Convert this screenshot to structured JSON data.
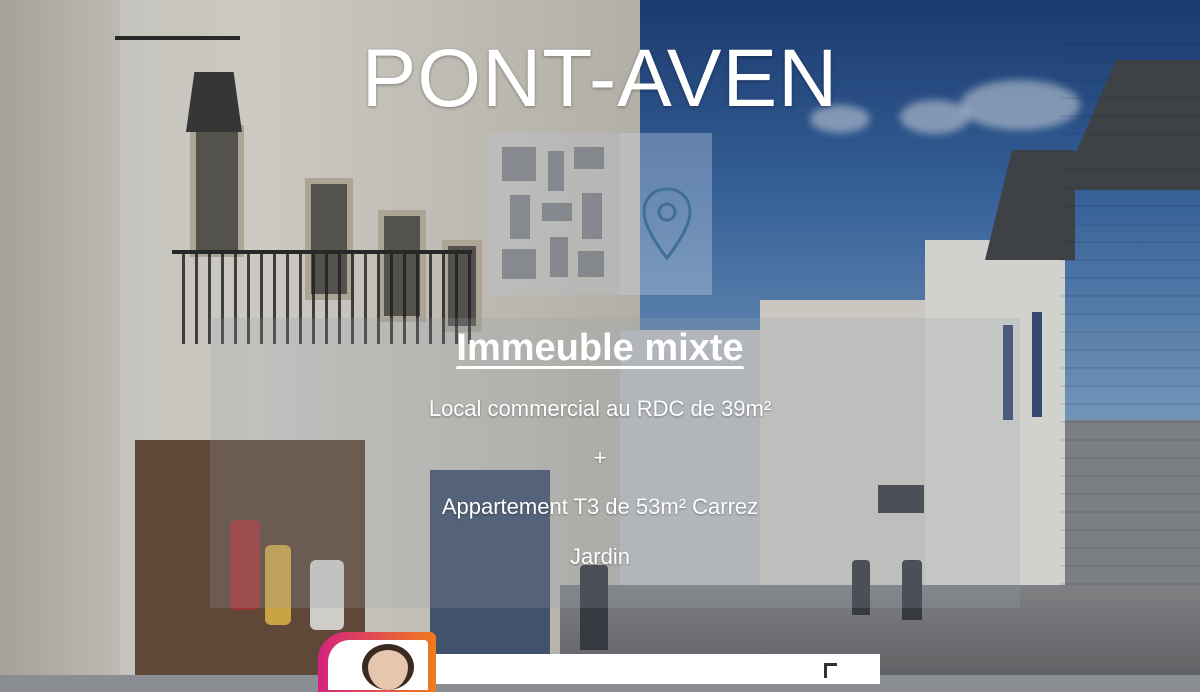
{
  "listing": {
    "town": "PONT-AVEN",
    "property_type": "Immeuble mixte",
    "details": [
      "Local commercial au RDC de 39m²",
      "+",
      "Appartement T3 de 53m² Carrez",
      "Jardin"
    ]
  },
  "icons": {
    "location": "map-pin-icon",
    "qr": "qr-code-icon",
    "agent": "agent-avatar"
  },
  "colors": {
    "text": "#ffffff",
    "pin_stroke": "#3e6f9a",
    "badge_gradient_start": "#d4237e",
    "badge_gradient_end": "#f07b1d"
  }
}
